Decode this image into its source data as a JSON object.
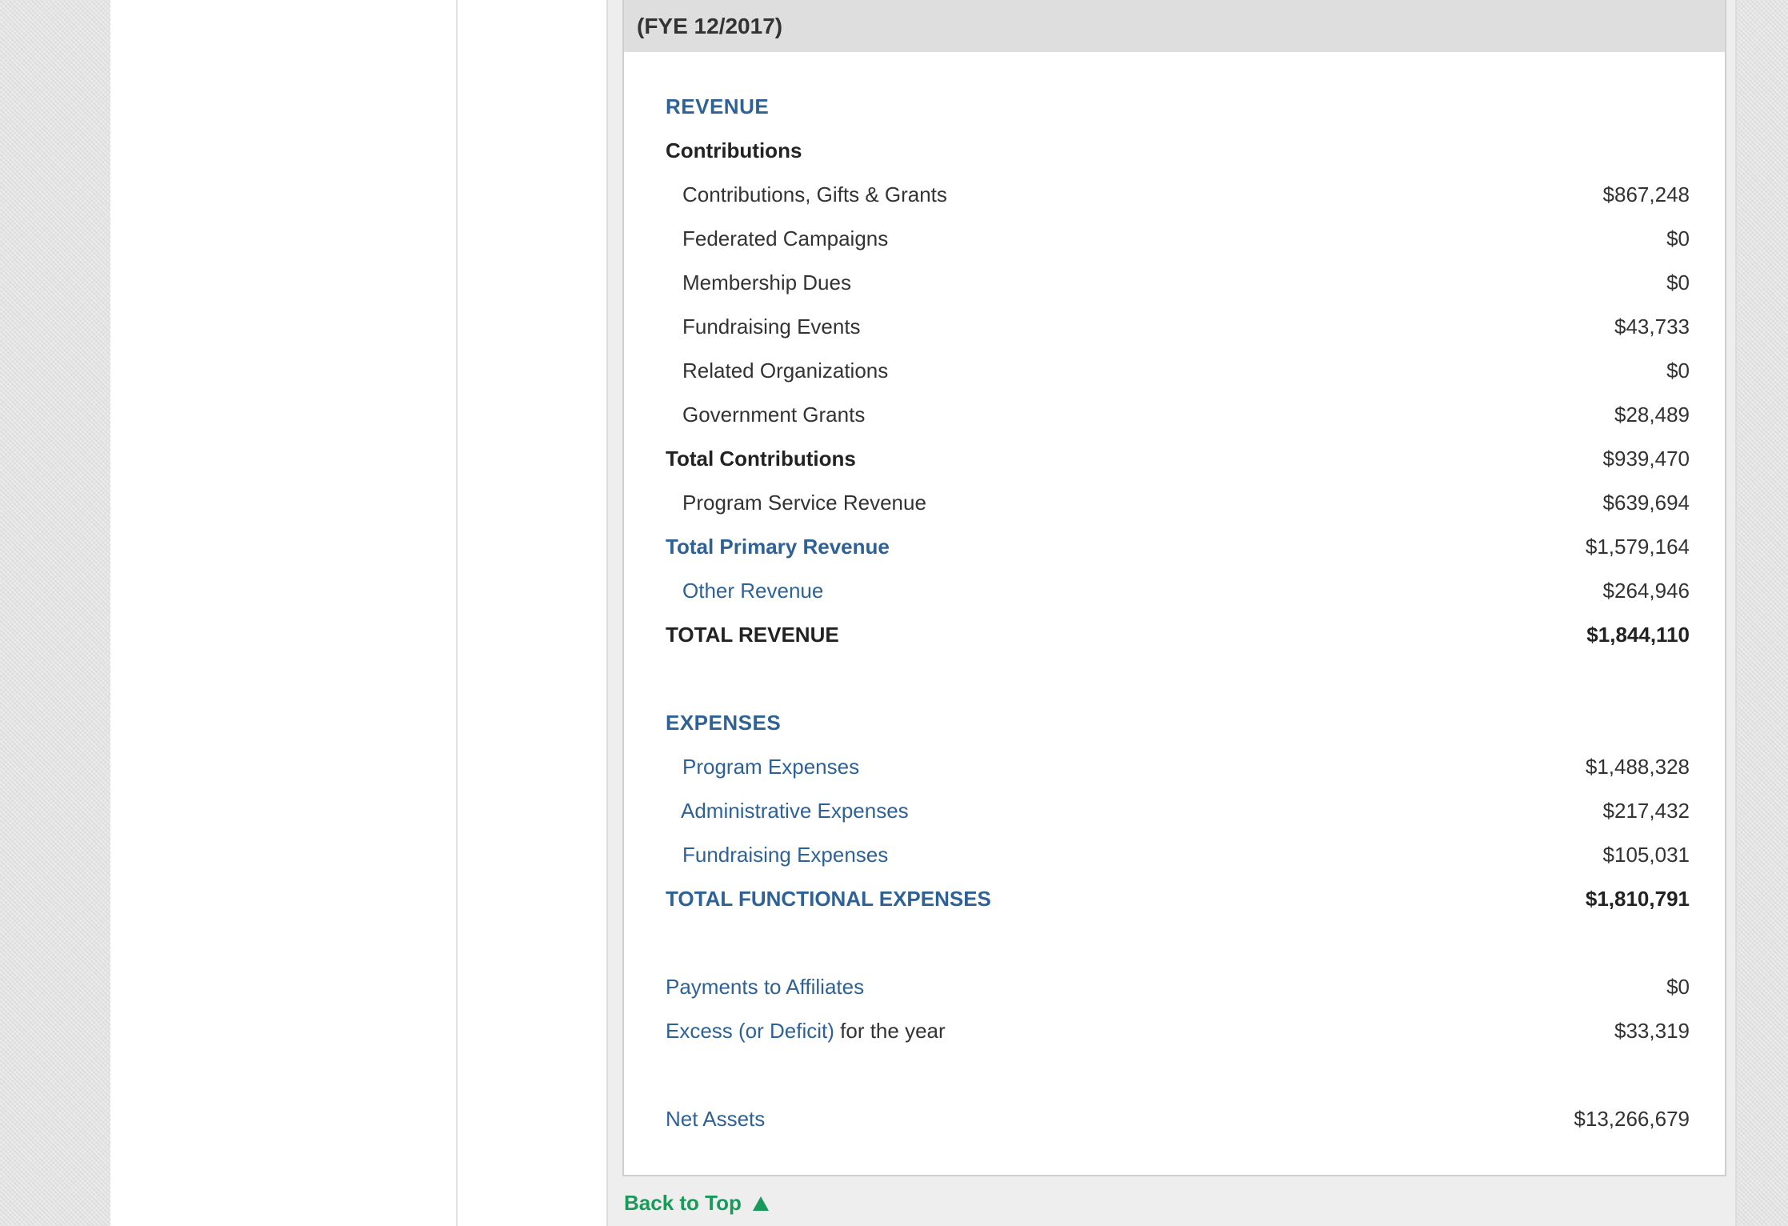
{
  "header": {
    "fiscal_year": "(FYE 12/2017)"
  },
  "revenue": {
    "heading": "REVENUE",
    "contributions_heading": "Contributions",
    "items": [
      {
        "label": "Contributions, Gifts & Grants",
        "value": "$867,248"
      },
      {
        "label": "Federated Campaigns",
        "value": "$0"
      },
      {
        "label": "Membership Dues",
        "value": "$0"
      },
      {
        "label": "Fundraising Events",
        "value": "$43,733"
      },
      {
        "label": "Related Organizations",
        "value": "$0"
      },
      {
        "label": "Government Grants",
        "value": "$28,489"
      }
    ],
    "total_contributions": {
      "label": "Total Contributions",
      "value": "$939,470"
    },
    "program_service_revenue": {
      "label": "Program Service Revenue",
      "value": "$639,694"
    },
    "total_primary_revenue": {
      "label": "Total Primary Revenue",
      "value": "$1,579,164"
    },
    "other_revenue": {
      "label": "Other Revenue",
      "value": "$264,946"
    },
    "total_revenue": {
      "label": "TOTAL REVENUE",
      "value": "$1,844,110"
    }
  },
  "expenses": {
    "heading": "EXPENSES",
    "program": {
      "label": "Program Expenses",
      "value": "$1,488,328"
    },
    "administrative": {
      "label": "Administrative Expenses",
      "value": "$217,432"
    },
    "fundraising": {
      "label": "Fundraising Expenses",
      "value": "$105,031"
    },
    "total_functional": {
      "label": "TOTAL FUNCTIONAL EXPENSES",
      "value": "$1,810,791"
    }
  },
  "other": {
    "payments_to_affiliates": {
      "label": "Payments to Affiliates",
      "value": "$0"
    },
    "excess_deficit": {
      "label_link": "Excess (or Deficit)",
      "label_suffix": " for the year",
      "value": "$33,319"
    },
    "net_assets": {
      "label": "Net Assets",
      "value": "$13,266,679"
    }
  },
  "back_to_top": {
    "label": "Back to Top",
    "icon": "triangle-up-icon",
    "color": "#1a9a5a"
  },
  "colors": {
    "accent_blue": "#2e6297",
    "header_gray": "#dedede",
    "text_dark": "#333333"
  }
}
